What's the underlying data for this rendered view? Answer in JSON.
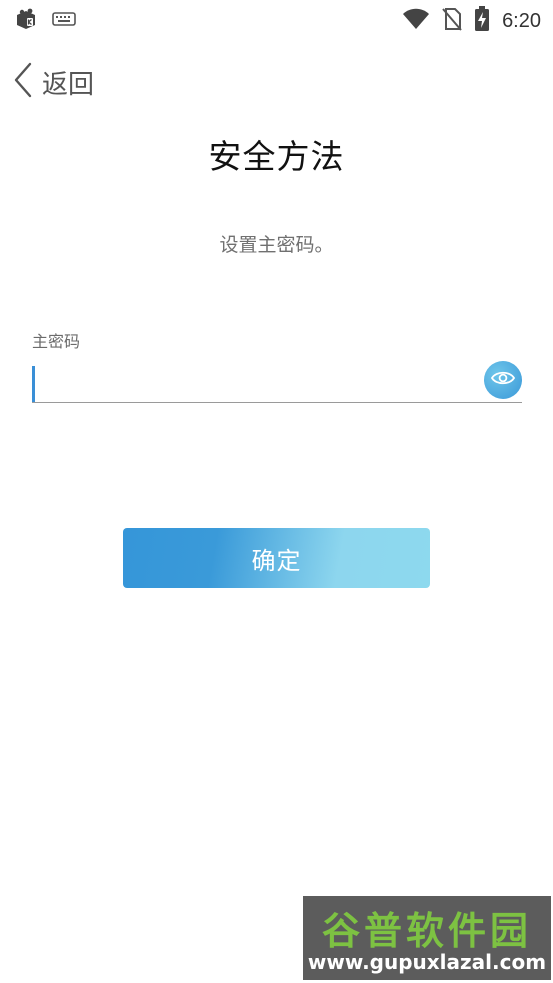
{
  "status_bar": {
    "time": "6:20",
    "icons": [
      "app-notification-icon",
      "keyboard-icon",
      "wifi-icon",
      "no-sim-icon",
      "battery-charging-icon"
    ]
  },
  "nav": {
    "back_label": "返回"
  },
  "header": {
    "title": "安全方法",
    "subtitle": "设置主密码。"
  },
  "form": {
    "password_label": "主密码",
    "password_value": "",
    "password_placeholder": ""
  },
  "actions": {
    "confirm_label": "确定"
  },
  "watermark": {
    "title": "谷普软件园",
    "url": "www.gupuxlazal.com"
  },
  "colors": {
    "accent": "#3a98d8",
    "button_gradient_start": "#3596d9",
    "button_gradient_end": "#8dd9ee",
    "watermark_green": "#7dc242"
  }
}
